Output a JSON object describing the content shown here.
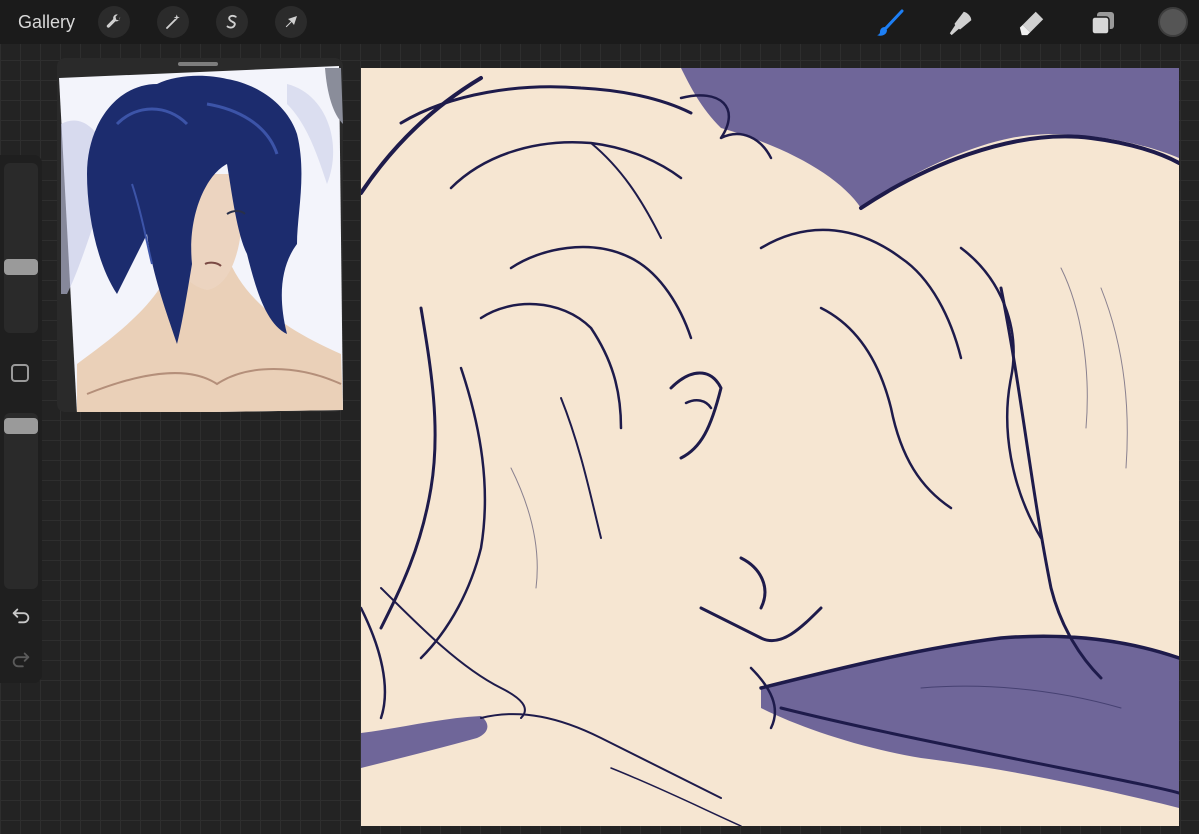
{
  "topbar": {
    "gallery_label": "Gallery",
    "left_tools": [
      {
        "name": "actions",
        "icon": "wrench-icon"
      },
      {
        "name": "adjustments",
        "icon": "magic-wand-icon"
      },
      {
        "name": "selection",
        "icon": "selection-s-icon"
      },
      {
        "name": "transform",
        "icon": "arrow-cursor-icon"
      }
    ],
    "right_tools": [
      {
        "name": "brush",
        "icon": "brush-icon",
        "active": true
      },
      {
        "name": "smudge",
        "icon": "smudge-icon"
      },
      {
        "name": "eraser",
        "icon": "eraser-icon"
      },
      {
        "name": "layers",
        "icon": "layers-icon"
      },
      {
        "name": "color",
        "icon": "color-swatch"
      }
    ]
  },
  "sidebar": {
    "brush_size_level": 0.55,
    "opacity_level": 0.05,
    "modify_button_icon": "square-icon",
    "undo_icon": "undo-icon",
    "redo_icon": "redo-icon"
  },
  "colors": {
    "active_tool": "#1d7ff5",
    "canvas_bg": "#f6e6d2",
    "purple_bg": "#6f6699",
    "line_art": "#1e1b4b"
  }
}
